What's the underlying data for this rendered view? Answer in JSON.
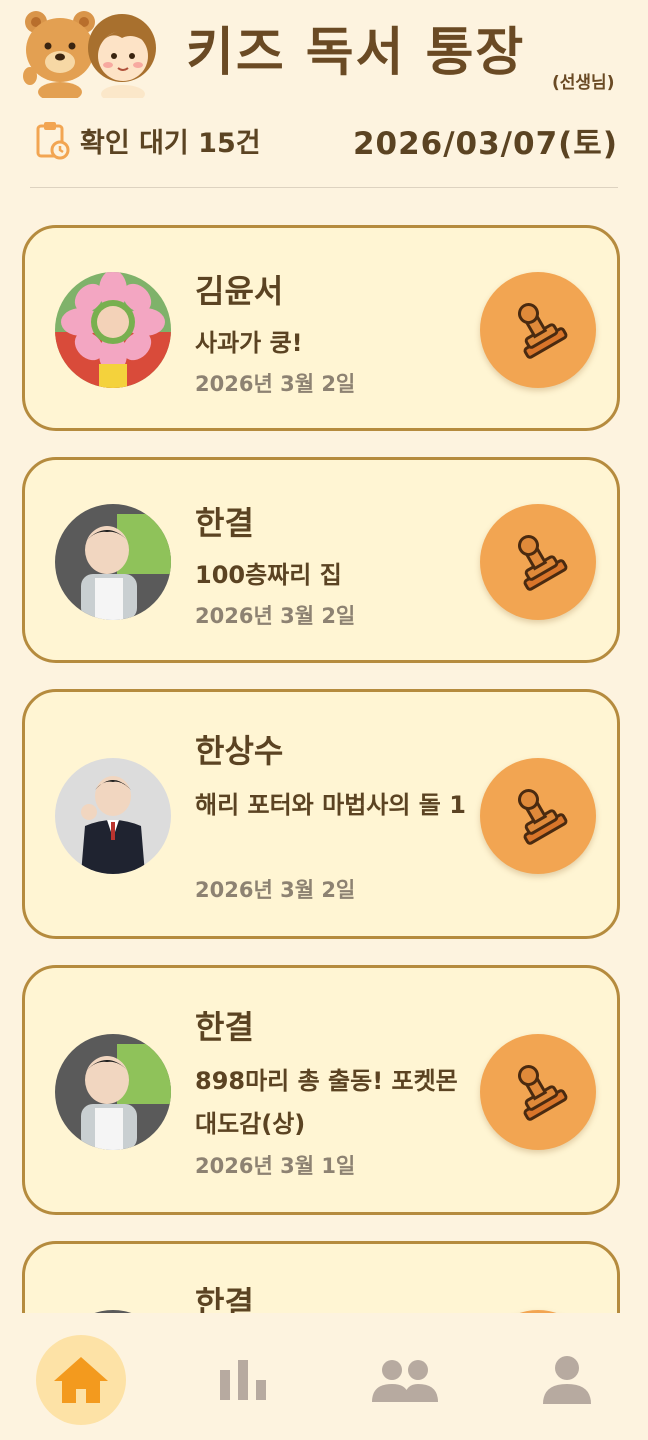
{
  "header": {
    "title": "키즈 독서 통장",
    "role": "(선생님)",
    "pending_label": "확인 대기 15건",
    "date": "2026/03/07(토)"
  },
  "cards": [
    {
      "name": "김윤서",
      "book": "사과가 쿵!",
      "date": "2026년 3월 2일"
    },
    {
      "name": "한결",
      "book": "100층짜리 집",
      "date": "2026년 3월 2일"
    },
    {
      "name": "한상수",
      "book": "해리 포터와 마법사의 돌 1",
      "date": "2026년 3월 2일"
    },
    {
      "name": "한결",
      "book": "898마리 총 출동! 포켓몬 대도감(상)",
      "date": "2026년 3월 1일"
    },
    {
      "name": "한결",
      "book": "",
      "date": ""
    }
  ],
  "nav": {
    "items": [
      {
        "icon": "home-icon",
        "active": true
      },
      {
        "icon": "bar-chart-icon",
        "active": false
      },
      {
        "icon": "group-icon",
        "active": false
      },
      {
        "icon": "person-icon",
        "active": false
      }
    ]
  },
  "colors": {
    "background": "#fdf3df",
    "card": "#fff5d3",
    "card_border": "#b58b3e",
    "stamp_button": "#f2a552",
    "active_nav": "#f39a1e",
    "inactive_nav": "#b7aaa0"
  }
}
